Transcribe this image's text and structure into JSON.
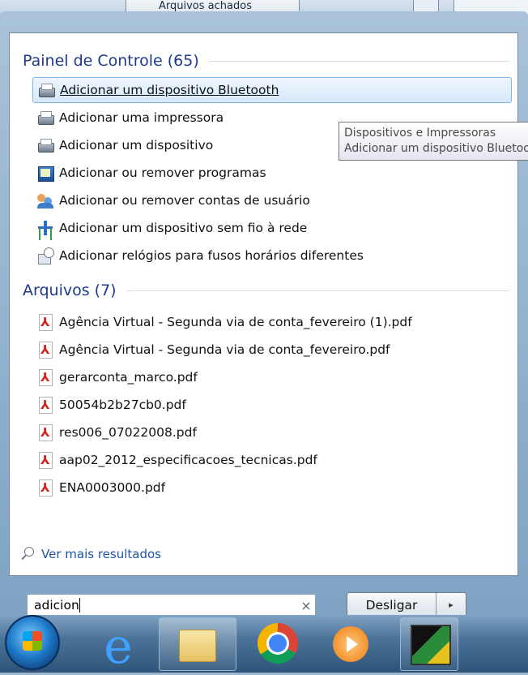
{
  "behind_window": {
    "tab_label": "Arquivos achados"
  },
  "control_panel": {
    "header": "Painel de Controle (65)",
    "items": [
      {
        "label": "Adicionar um dispositivo Bluetooth",
        "icon": "devices-printers-icon",
        "selected": true
      },
      {
        "label": "Adicionar uma impressora",
        "icon": "devices-printers-icon"
      },
      {
        "label": "Adicionar um dispositivo",
        "icon": "devices-printers-icon"
      },
      {
        "label": "Adicionar ou remover programas",
        "icon": "programs-features-icon"
      },
      {
        "label": "Adicionar ou remover contas de usuário",
        "icon": "user-accounts-icon"
      },
      {
        "label": "Adicionar um dispositivo sem fio à rede",
        "icon": "network-icon"
      },
      {
        "label": "Adicionar relógios para fusos horários diferentes",
        "icon": "clock-icon"
      }
    ]
  },
  "tooltip": {
    "line1": "Dispositivos e Impressoras",
    "line2": "Adicionar um dispositivo Bluetooth"
  },
  "files": {
    "header": "Arquivos (7)",
    "items": [
      {
        "label": "Agência Virtual - Segunda via de conta_fevereiro (1).pdf",
        "icon": "pdf-icon"
      },
      {
        "label": "Agência Virtual - Segunda via de conta_fevereiro.pdf",
        "icon": "pdf-icon"
      },
      {
        "label": "gerarconta_marco.pdf",
        "icon": "pdf-icon"
      },
      {
        "label": "50054b2b27cb0.pdf",
        "icon": "pdf-icon"
      },
      {
        "label": "res006_07022008.pdf",
        "icon": "pdf-icon"
      },
      {
        "label": "aap02_2012_especificacoes_tecnicas.pdf",
        "icon": "pdf-icon"
      },
      {
        "label": "ENA0003000.pdf",
        "icon": "pdf-icon"
      }
    ]
  },
  "more_results": "Ver mais resultados",
  "search": {
    "value": "adicion",
    "clear_glyph": "×"
  },
  "shutdown": {
    "label": "Desligar",
    "arrow_glyph": "▸"
  },
  "taskbar": {
    "icons": [
      "start-orb-icon",
      "internet-explorer-icon",
      "windows-explorer-icon",
      "chrome-icon",
      "media-player-icon",
      "app-icon"
    ]
  }
}
